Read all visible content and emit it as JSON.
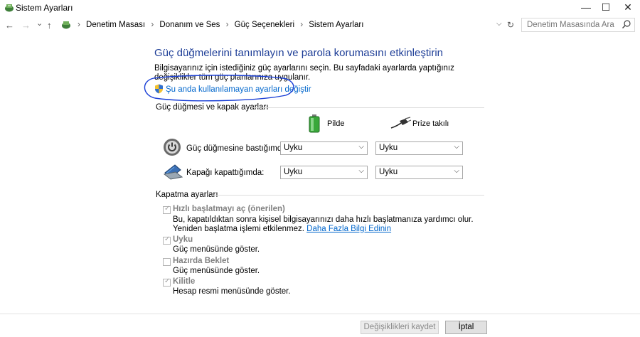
{
  "window": {
    "title": "Sistem Ayarları",
    "minimize": "—",
    "maximize": "☐",
    "close": "✕"
  },
  "nav": {
    "back": "←",
    "forward": "→",
    "recent": "⌄",
    "up": "↑"
  },
  "breadcrumb": [
    "Denetim Masası",
    "Donanım ve Ses",
    "Güç Seçenekleri",
    "Sistem Ayarları"
  ],
  "breadcrumb_sep": "›",
  "search": {
    "placeholder": "Denetim Masasında Ara"
  },
  "page": {
    "heading": "Güç düğmelerini tanımlayın ve parola korumasını etkinleştirin",
    "description": "Bilgisayarınız için istediğiniz güç ayarlarını seçin. Bu sayfadaki ayarlarda yaptığınız değişiklikler tüm güç planlarınıza uygulanır.",
    "change_link": "Şu anda kullanılamayan ayarları değiştir"
  },
  "power_group": {
    "title": "Güç düğmesi ve kapak ayarları",
    "col_battery": "Pilde",
    "col_plugged": "Prize takılı",
    "rows": [
      {
        "label": "Güç düğmesine bastığımda:",
        "battery": "Uyku",
        "plugged": "Uyku"
      },
      {
        "label": "Kapağı kapattığımda:",
        "battery": "Uyku",
        "plugged": "Uyku"
      }
    ]
  },
  "shutdown_group": {
    "title": "Kapatma ayarları",
    "items": [
      {
        "label": "Hızlı başlatmayı aç (önerilen)",
        "desc": "Bu, kapatıldıktan sonra kişisel bilgisayarınızı daha hızlı başlatmanıza yardımcı olur. Yeniden başlatma işlemi etkilenmez.",
        "link": "Daha Fazla Bilgi Edinin",
        "checked": true
      },
      {
        "label": "Uyku",
        "desc": "Güç menüsünde göster.",
        "checked": true
      },
      {
        "label": "Hazırda Beklet",
        "desc": "Güç menüsünde göster.",
        "checked": false
      },
      {
        "label": "Kilitle",
        "desc": "Hesap resmi menüsünde göster.",
        "checked": true
      }
    ]
  },
  "footer": {
    "save": "Değişiklikleri kaydet",
    "cancel": "İptal"
  },
  "colors": {
    "heading": "#1e3e97",
    "link": "#0066cc",
    "annotation": "#1a3fd6"
  }
}
